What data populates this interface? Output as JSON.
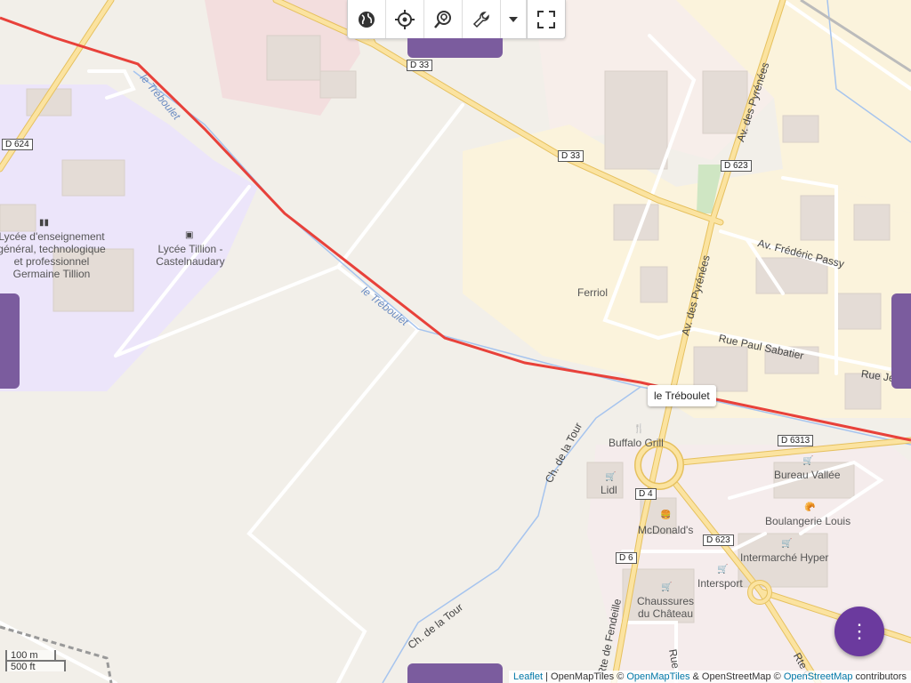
{
  "toolbar": {
    "buttons": [
      {
        "name": "globe-icon",
        "icon": "globe"
      },
      {
        "name": "locate-icon",
        "icon": "crosshair"
      },
      {
        "name": "search-location-icon",
        "icon": "search-pin"
      },
      {
        "name": "wrench-icon",
        "icon": "wrench"
      },
      {
        "name": "caret-down-icon",
        "icon": "caret"
      },
      {
        "name": "fullscreen-icon",
        "icon": "expand"
      }
    ]
  },
  "route": {
    "color": "#e8413a"
  },
  "tooltip": {
    "text": "le Tréboulet"
  },
  "fab": {
    "icon": "more-vertical",
    "label": "⋮",
    "color": "#6b3a9e"
  },
  "panel_tabs": {
    "color": "#7b5c9e"
  },
  "scale": {
    "metric": "100 m",
    "imperial": "500 ft"
  },
  "attribution": {
    "leaflet": "Leaflet",
    "sep1": " | OpenMapTiles © ",
    "openmaptiles": "OpenMapTiles",
    "sep2": " & OpenStreetMap © ",
    "osm": "OpenStreetMap",
    "tail": " contributors"
  },
  "map": {
    "roads": {
      "d624": "D 624",
      "d33_a": "D 33",
      "d33_b": "D 33",
      "d623_a": "D 623",
      "d623_b": "D 623",
      "d6313": "D 6313",
      "d4": "D 4",
      "d6": "D 6"
    },
    "streets": {
      "av_pyrenees_1": "Av. des Pyrénées",
      "av_pyrenees_2": "Av. des Pyrénées",
      "av_frederic_passy": "Av. Frédéric Passy",
      "rue_paul_sabatier": "Rue Paul Sabatier",
      "rue_jean": "Rue Jean",
      "ch_tour_1": "Ch. de la Tour",
      "ch_tour_2": "Ch. de la Tour",
      "rte_fendeille": "Rte de Fendeille",
      "rue_partial": "Rue",
      "rte_partial": "Rte d"
    },
    "waterways": {
      "treboulet_1": "le Tréboulet",
      "treboulet_2": "le Tréboulet"
    },
    "places": {
      "lycee_1": "Lycée d'enseignement",
      "lycee_2": "général, technologique",
      "lycee_3": "et professionnel",
      "lycee_4": "Germaine Tillion",
      "bus_stop_1": "Lycée Tillion -",
      "bus_stop_2": "Castelnaudary",
      "ferriol": "Ferriol",
      "buffalo": "Buffalo Grill",
      "lidl": "Lidl",
      "mcdonalds": "McDonald's",
      "bureau": "Bureau Vallée",
      "boulangerie": "Boulangerie Louis",
      "intermarche": "Intermarché Hyper",
      "intersport": "Intersport",
      "chaussures_1": "Chaussures",
      "chaussures_2": "du Château"
    }
  }
}
